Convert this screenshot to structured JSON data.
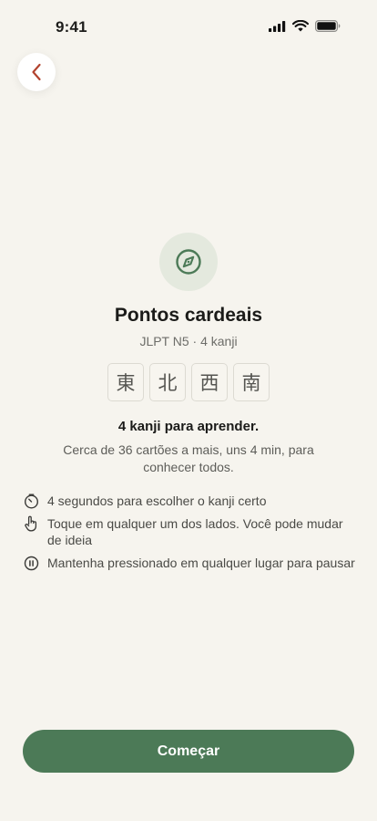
{
  "status_bar": {
    "time": "9:41"
  },
  "icons": {
    "back": "chevron-left-icon",
    "hero": "compass-icon",
    "tips": [
      "timer-icon",
      "hand-pointer-icon",
      "pause-icon"
    ]
  },
  "colors": {
    "background": "#f6f4ee",
    "accent": "#4c7a57",
    "back_chevron": "#b2432f",
    "hero_circle": "#e4e9de"
  },
  "lesson": {
    "title": "Pontos cardeais",
    "subtitle": "JLPT N5 · 4 kanji",
    "kanji": [
      "東",
      "北",
      "西",
      "南"
    ]
  },
  "learn": {
    "heading": "4 kanji para aprender.",
    "description": "Cerca de 36 cartões a mais, uns 4 min, para conhecer todos."
  },
  "tips": [
    "4 segundos para escolher o kanji certo",
    "Toque em qualquer um dos lados. Você pode mudar de ideia",
    "Mantenha pressionado em qualquer lugar para pausar"
  ],
  "actions": {
    "start_label": "Começar"
  }
}
